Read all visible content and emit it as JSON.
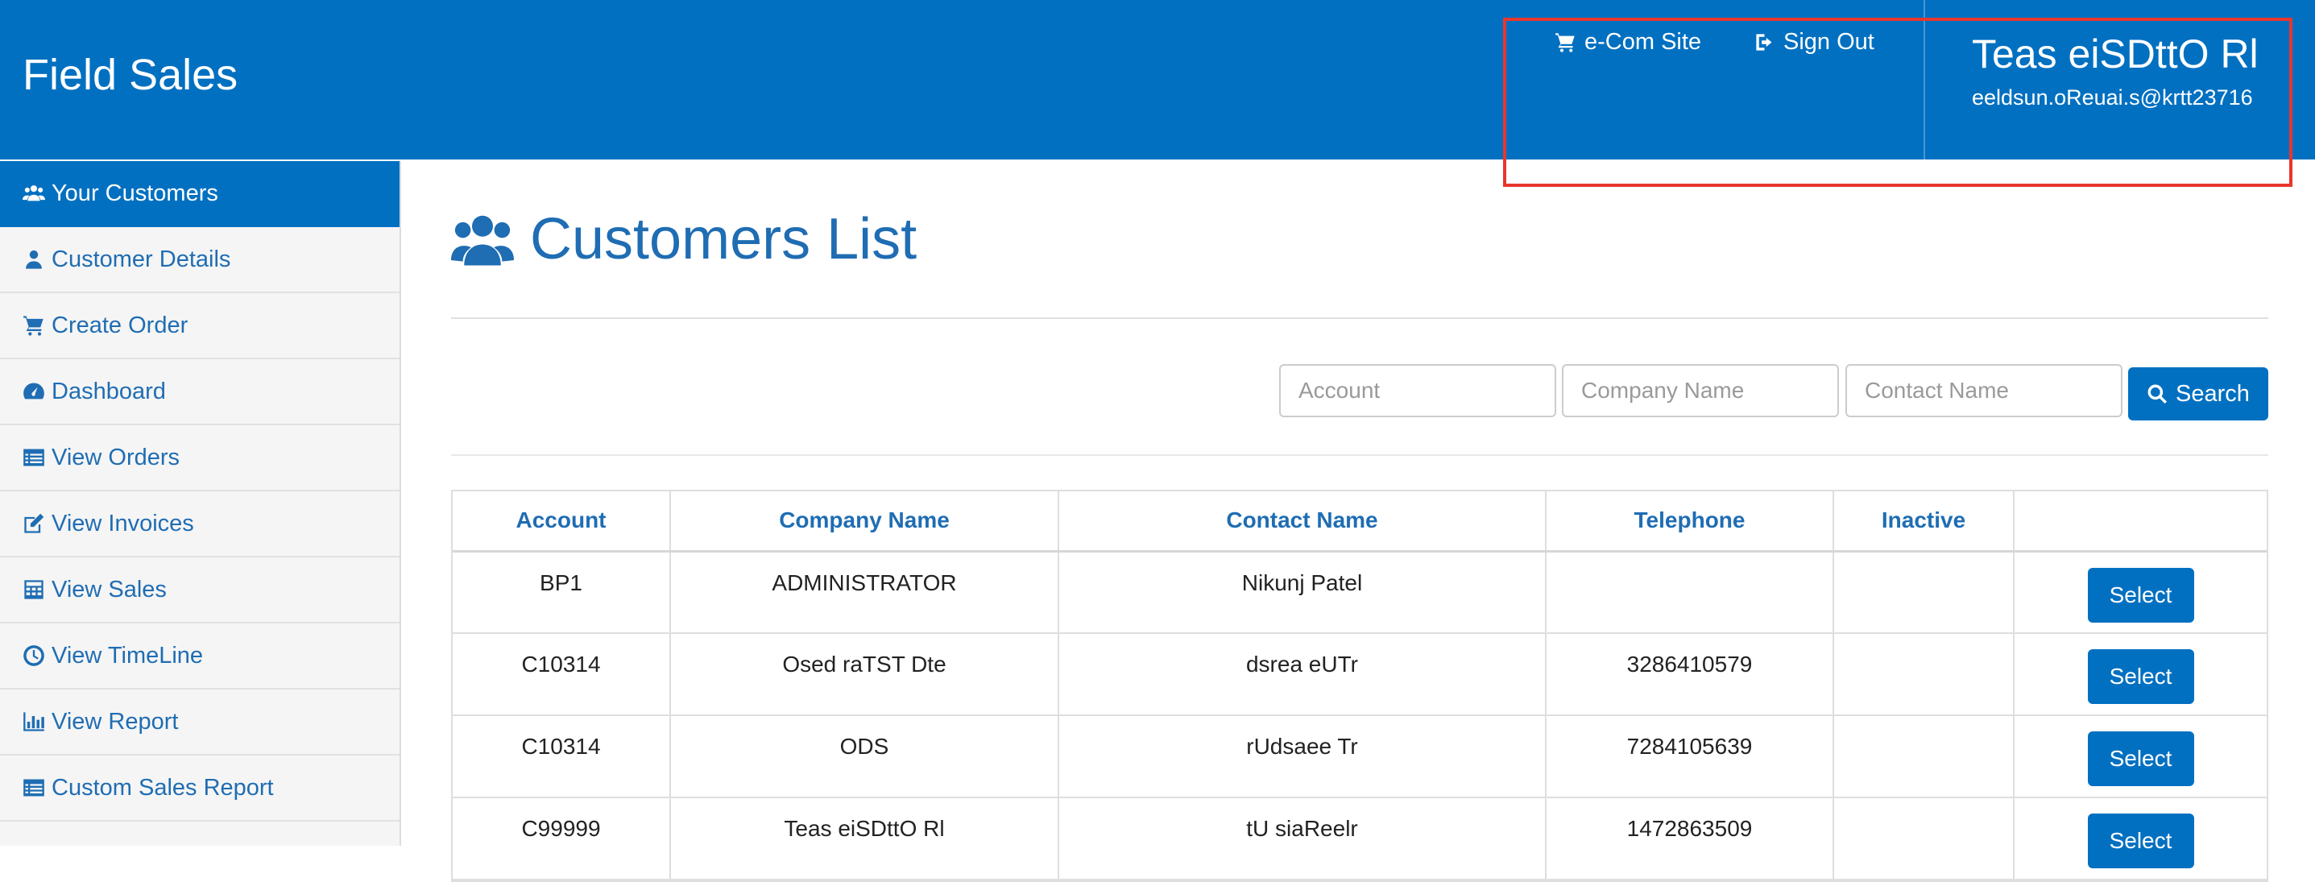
{
  "header": {
    "brand": "Field Sales",
    "ecom_label": "e-Com Site",
    "signout_label": "Sign Out",
    "user_name": "Teas eiSDttO Rl",
    "user_email": "eeldsun.oReuai.s@krtt23716"
  },
  "sidebar": {
    "items": [
      {
        "label": "Your Customers",
        "icon": "users-icon",
        "active": true
      },
      {
        "label": "Customer Details",
        "icon": "user-icon"
      },
      {
        "label": "Create Order",
        "icon": "cart-icon"
      },
      {
        "label": "Dashboard",
        "icon": "dashboard-icon"
      },
      {
        "label": "View Orders",
        "icon": "list-icon"
      },
      {
        "label": "View Invoices",
        "icon": "edit-icon"
      },
      {
        "label": "View Sales",
        "icon": "calculator-icon"
      },
      {
        "label": "View TimeLine",
        "icon": "clock-icon"
      },
      {
        "label": "View Report",
        "icon": "bar-chart-icon"
      },
      {
        "label": "Custom Sales Report",
        "icon": "list-icon"
      }
    ]
  },
  "main": {
    "title": "Customers List",
    "search": {
      "account_placeholder": "Account",
      "company_placeholder": "Company Name",
      "contact_placeholder": "Contact Name",
      "button_label": "Search"
    },
    "table": {
      "columns": [
        "Account",
        "Company Name",
        "Contact Name",
        "Telephone",
        "Inactive",
        ""
      ],
      "select_label": "Select",
      "rows": [
        {
          "account": "BP1",
          "company": "ADMINISTRATOR",
          "contact": "Nikunj Patel",
          "telephone": "",
          "inactive": ""
        },
        {
          "account": "C10314",
          "company": "Osed raTST Dte",
          "contact": "dsrea eUTr",
          "telephone": "3286410579",
          "inactive": ""
        },
        {
          "account": "C10314",
          "company": "ODS",
          "contact": "rUdsaee Tr",
          "telephone": "7284105639",
          "inactive": ""
        },
        {
          "account": "C99999",
          "company": "Teas eiSDttO Rl",
          "contact": "tU siaReelr",
          "telephone": "1472863509",
          "inactive": ""
        }
      ]
    }
  },
  "colors": {
    "primary": "#0170c1",
    "link": "#1f6db3",
    "annotation": "#e8362c"
  }
}
